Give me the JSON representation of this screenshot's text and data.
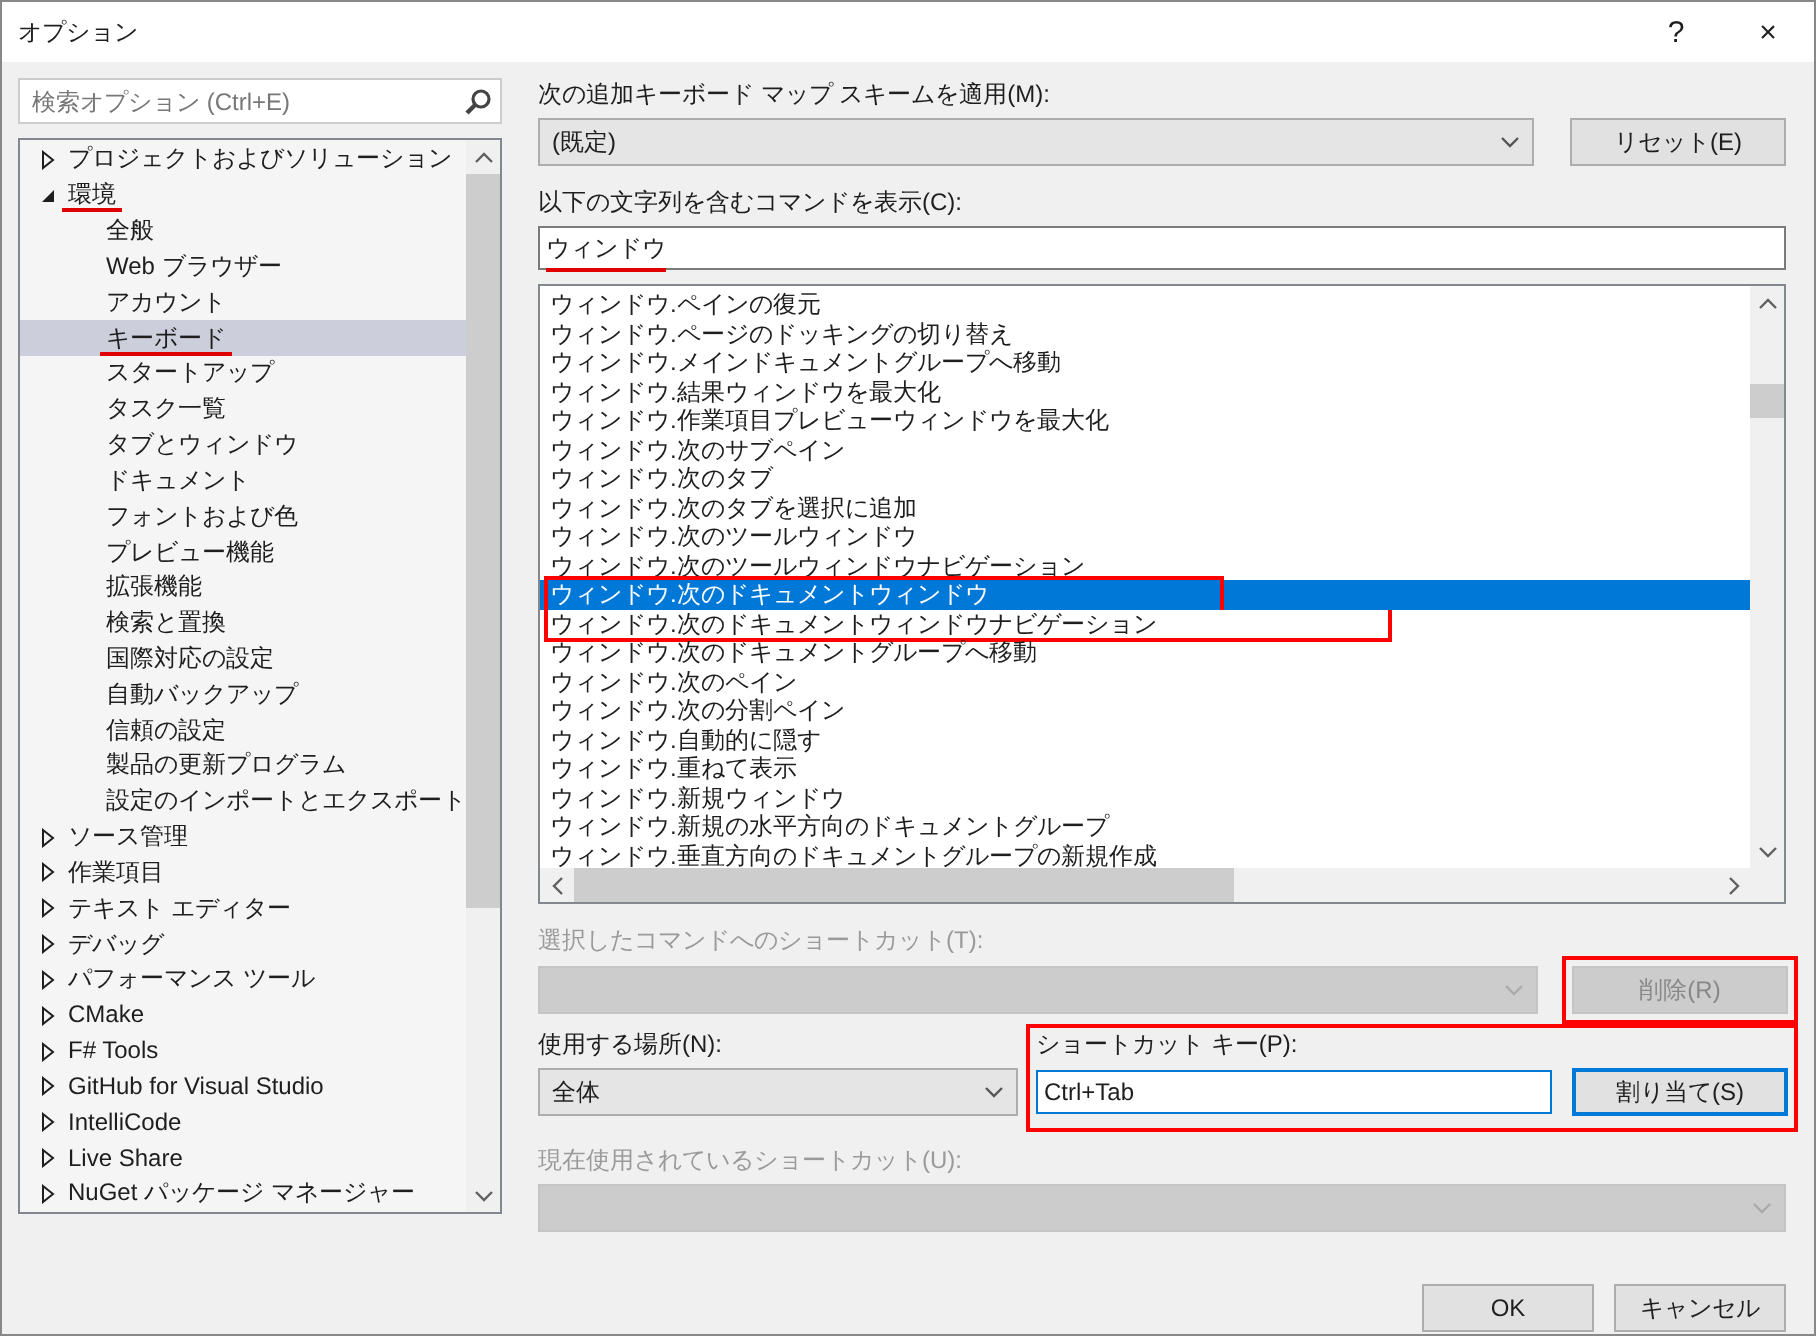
{
  "window": {
    "title": "オプション",
    "help": "?",
    "close": "×"
  },
  "search": {
    "placeholder": "検索オプション (Ctrl+E)"
  },
  "tree": [
    {
      "label": "プロジェクトおよびソリューション",
      "expanded": false,
      "selected": false,
      "marked": false
    },
    {
      "label": "環境",
      "expanded": true,
      "selected": false,
      "marked": true,
      "children": [
        {
          "label": "全般",
          "selected": false,
          "marked": false
        },
        {
          "label": "Web ブラウザー",
          "selected": false,
          "marked": false
        },
        {
          "label": "アカウント",
          "selected": false,
          "marked": false
        },
        {
          "label": "キーボード",
          "selected": true,
          "marked": true
        },
        {
          "label": "スタートアップ",
          "selected": false,
          "marked": false
        },
        {
          "label": "タスク一覧",
          "selected": false,
          "marked": false
        },
        {
          "label": "タブとウィンドウ",
          "selected": false,
          "marked": false
        },
        {
          "label": "ドキュメント",
          "selected": false,
          "marked": false
        },
        {
          "label": "フォントおよび色",
          "selected": false,
          "marked": false
        },
        {
          "label": "プレビュー機能",
          "selected": false,
          "marked": false
        },
        {
          "label": "拡張機能",
          "selected": false,
          "marked": false
        },
        {
          "label": "検索と置換",
          "selected": false,
          "marked": false
        },
        {
          "label": "国際対応の設定",
          "selected": false,
          "marked": false
        },
        {
          "label": "自動バックアップ",
          "selected": false,
          "marked": false
        },
        {
          "label": "信頼の設定",
          "selected": false,
          "marked": false
        },
        {
          "label": "製品の更新プログラム",
          "selected": false,
          "marked": false
        },
        {
          "label": "設定のインポートとエクスポート",
          "selected": false,
          "marked": false
        }
      ]
    },
    {
      "label": "ソース管理",
      "expanded": false,
      "selected": false,
      "marked": false
    },
    {
      "label": "作業項目",
      "expanded": false,
      "selected": false,
      "marked": false
    },
    {
      "label": "テキスト エディター",
      "expanded": false,
      "selected": false,
      "marked": false
    },
    {
      "label": "デバッグ",
      "expanded": false,
      "selected": false,
      "marked": false
    },
    {
      "label": "パフォーマンス ツール",
      "expanded": false,
      "selected": false,
      "marked": false
    },
    {
      "label": "CMake",
      "expanded": false,
      "selected": false,
      "marked": false
    },
    {
      "label": "F# Tools",
      "expanded": false,
      "selected": false,
      "marked": false
    },
    {
      "label": "GitHub for Visual Studio",
      "expanded": false,
      "selected": false,
      "marked": false
    },
    {
      "label": "IntelliCode",
      "expanded": false,
      "selected": false,
      "marked": false
    },
    {
      "label": "Live Share",
      "expanded": false,
      "selected": false,
      "marked": false
    },
    {
      "label": "NuGet パッケージ マネージャー",
      "expanded": false,
      "selected": false,
      "marked": false
    }
  ],
  "scheme": {
    "label": "次の追加キーボード マップ スキームを適用(M):",
    "value": "(既定)",
    "button": "リセット(E)"
  },
  "filter": {
    "label": "以下の文字列を含むコマンドを表示(C):",
    "value": "ウィンドウ",
    "marked": true
  },
  "commands": [
    {
      "label": "ウィンドウ.ペインの復元",
      "selected": false,
      "marked": false
    },
    {
      "label": "ウィンドウ.ページのドッキングの切り替え",
      "selected": false,
      "marked": false
    },
    {
      "label": "ウィンドウ.メインドキュメントグループへ移動",
      "selected": false,
      "marked": false
    },
    {
      "label": "ウィンドウ.結果ウィンドウを最大化",
      "selected": false,
      "marked": false
    },
    {
      "label": "ウィンドウ.作業項目プレビューウィンドウを最大化",
      "selected": false,
      "marked": false
    },
    {
      "label": "ウィンドウ.次のサブペイン",
      "selected": false,
      "marked": false
    },
    {
      "label": "ウィンドウ.次のタブ",
      "selected": false,
      "marked": false
    },
    {
      "label": "ウィンドウ.次のタブを選択に追加",
      "selected": false,
      "marked": false
    },
    {
      "label": "ウィンドウ.次のツールウィンドウ",
      "selected": false,
      "marked": false
    },
    {
      "label": "ウィンドウ.次のツールウィンドウナビゲーション",
      "selected": false,
      "marked": false
    },
    {
      "label": "ウィンドウ.次のドキュメントウィンドウ",
      "selected": true,
      "marked": true
    },
    {
      "label": "ウィンドウ.次のドキュメントウィンドウナビゲーション",
      "selected": false,
      "marked": true
    },
    {
      "label": "ウィンドウ.次のドキュメントグループへ移動",
      "selected": false,
      "marked": false
    },
    {
      "label": "ウィンドウ.次のペイン",
      "selected": false,
      "marked": false
    },
    {
      "label": "ウィンドウ.次の分割ペイン",
      "selected": false,
      "marked": false
    },
    {
      "label": "ウィンドウ.自動的に隠す",
      "selected": false,
      "marked": false
    },
    {
      "label": "ウィンドウ.重ねて表示",
      "selected": false,
      "marked": false
    },
    {
      "label": "ウィンドウ.新規ウィンドウ",
      "selected": false,
      "marked": false
    },
    {
      "label": "ウィンドウ.新規の水平方向のドキュメントグループ",
      "selected": false,
      "marked": false
    },
    {
      "label": "ウィンドウ.垂直方向のドキュメントグループの新規作成",
      "selected": false,
      "marked": false
    }
  ],
  "current_shortcut": {
    "label": "選択したコマンドへのショートカット(T):",
    "disabled": true,
    "button": "削除(R)",
    "button_marked": true
  },
  "scope": {
    "label": "使用する場所(N):",
    "value": "全体"
  },
  "shortcut_key": {
    "label": "ショートカット キー(P):",
    "value": "Ctrl+Tab",
    "button": "割り当て(S)",
    "marked": true
  },
  "in_use": {
    "label": "現在使用されているショートカット(U):",
    "disabled": true
  },
  "buttons": [
    "OK",
    "キャンセル"
  ]
}
